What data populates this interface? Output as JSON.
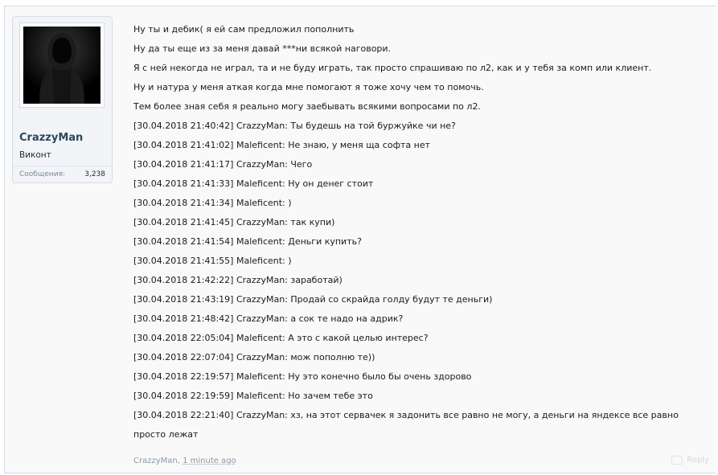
{
  "user": {
    "name": "CrazzyMan",
    "title": "Виконт",
    "stats_label": "Сообщения:",
    "stats_value": "3,238"
  },
  "message": {
    "lines": [
      "Ну ты и дебик( я ей сам предложил пополнить",
      "Ну да ты еще из за меня давай ***ни всякой наговори.",
      "Я с ней некогда не играл, та и не буду играть, так просто спрашиваю по л2, как и у тебя за комп или клиент.",
      "Ну и натура у меня аткая когда мне помогают я тоже хочу чем то помочь.",
      "Тем более зная себя я реально могу заебывать всякими вопросами по л2.",
      "[30.04.2018 21:40:42] CrazzyMan: Ты будешь на той буржуйке чи не?",
      "[30.04.2018 21:41:02] Maleficent: Не знаю, у меня ща софта нет",
      "[30.04.2018 21:41:17] CrazzyMan: Чего",
      "[30.04.2018 21:41:33] Maleficent: Ну он денег стоит",
      "[30.04.2018 21:41:34] Maleficent: )",
      "[30.04.2018 21:41:45] CrazzyMan: так купи)",
      "[30.04.2018 21:41:54] Maleficent: Деньги купить?",
      "[30.04.2018 21:41:55] Maleficent: )",
      "[30.04.2018 21:42:22] CrazzyMan: заработай)",
      "[30.04.2018 21:43:19] CrazzyMan: Продай со скрайда голду будут те деньги)",
      "[30.04.2018 21:48:42] CrazzyMan: а сок те надо на адрик?",
      "[30.04.2018 22:05:04] Maleficent: А это с какой целью интерес?",
      "[30.04.2018 22:07:04] CrazzyMan: мож пополню те))",
      "[30.04.2018 22:19:57] Maleficent: Ну это конечно было бы очень здорово",
      "[30.04.2018 22:19:59] Maleficent: Но зачем тебе это",
      "[30.04.2018 22:21:40] CrazzyMan: хз, на этот сервачек я задонить все равно не могу, а деньги на яндексе все равно просто лежат"
    ]
  },
  "footer": {
    "author": "CrazzyMan",
    "separator": ", ",
    "time": "1 minute ago",
    "reply_label": "Reply"
  }
}
